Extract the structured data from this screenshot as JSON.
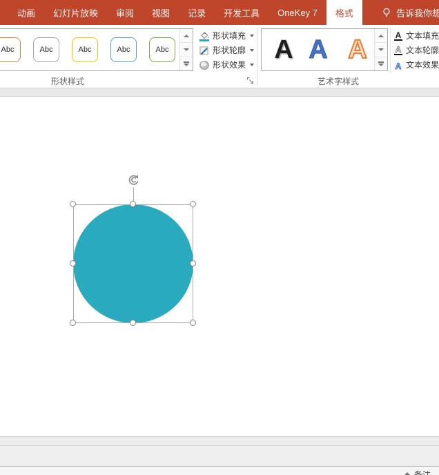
{
  "colors": {
    "ribbon_red": "#C0462B",
    "shape_teal": "#29AABE",
    "gallery_border_orange": "#ED7D31",
    "gallery_border_gray": "#A5A5A5",
    "gallery_border_gold": "#FFC000",
    "gallery_border_blue": "#5B9BD5",
    "gallery_border_green": "#70AD47"
  },
  "tabbar": {
    "tabs": [
      {
        "label": "动画"
      },
      {
        "label": "幻灯片放映"
      },
      {
        "label": "审阅"
      },
      {
        "label": "视图"
      },
      {
        "label": "记录"
      },
      {
        "label": "开发工具"
      },
      {
        "label": "OneKey 7"
      },
      {
        "label": "格式",
        "active": true
      }
    ],
    "tell_me": {
      "label": "告诉我你想要",
      "icon": "lightbulb-icon"
    }
  },
  "ribbon": {
    "shape_styles": {
      "group_label": "形状样式",
      "gallery": {
        "items": [
          {
            "label": "Abc",
            "border_color": "#ED7D31"
          },
          {
            "label": "Abc",
            "border_color": "#A5A5A5"
          },
          {
            "label": "Abc",
            "border_color": "#FFC000"
          },
          {
            "label": "Abc",
            "border_color": "#5B9BD5"
          },
          {
            "label": "Abc",
            "border_color": "#70AD47"
          }
        ]
      },
      "buttons": [
        {
          "label": "形状填充",
          "icon": "paint-bucket-icon",
          "swatch_color": "#29AABE"
        },
        {
          "label": "形状轮廓",
          "icon": "pencil-outline-icon"
        },
        {
          "label": "形状效果",
          "icon": "shape-effects-icon"
        }
      ]
    },
    "wordart_styles": {
      "group_label": "艺术字样式",
      "gallery": {
        "items": [
          {
            "label": "A",
            "style": "black-shadow"
          },
          {
            "label": "A",
            "style": "blue-fill"
          },
          {
            "label": "A",
            "style": "orange-outline"
          }
        ]
      },
      "buttons": [
        {
          "label": "文本填充",
          "icon": "text-fill-icon",
          "icon_letter": "A"
        },
        {
          "label": "文本轮廓",
          "icon": "text-outline-icon",
          "icon_letter": "A"
        },
        {
          "label": "文本效果",
          "icon": "text-effects-icon",
          "icon_letter": "A"
        }
      ]
    }
  },
  "canvas": {
    "shape": {
      "type": "circle",
      "fill_color": "#29AABE",
      "selected": true
    }
  },
  "notes_bar": {
    "label": "备注"
  }
}
